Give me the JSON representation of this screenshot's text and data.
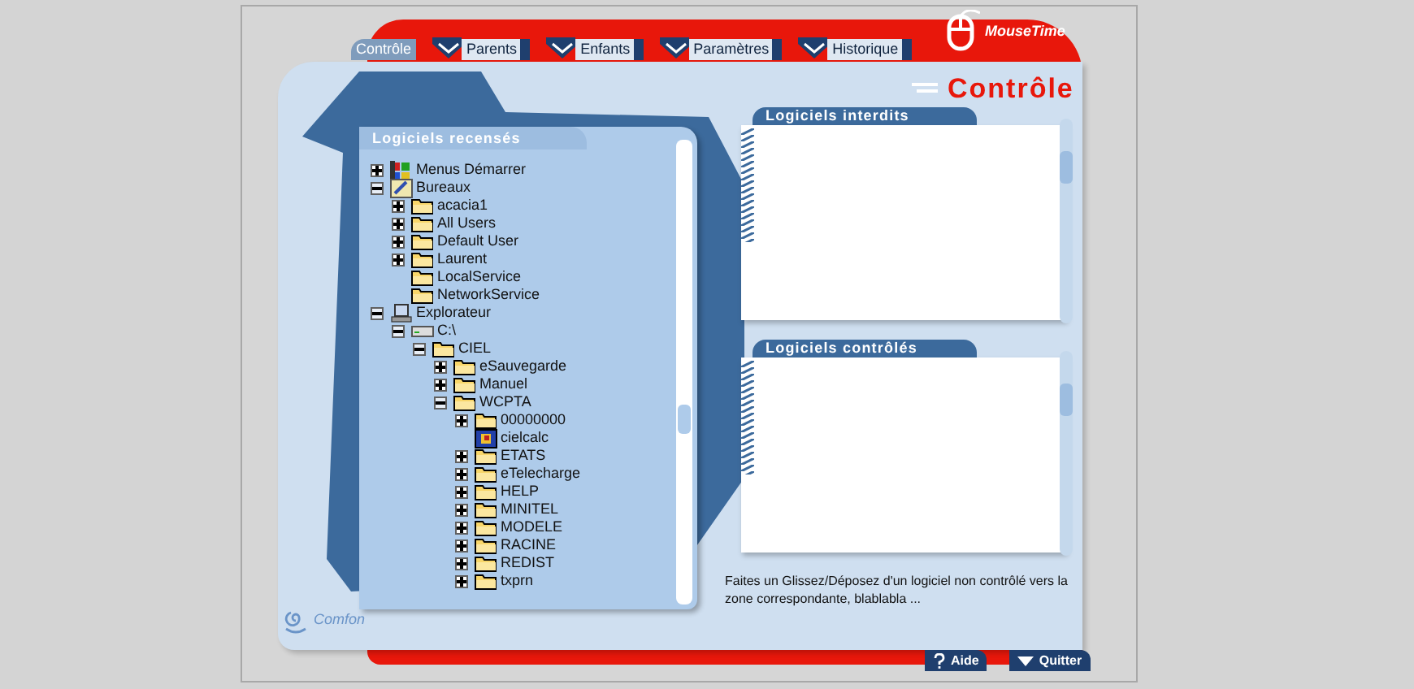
{
  "brand": {
    "name": "MouseTime"
  },
  "tabs": [
    {
      "label": "Contrôle",
      "selected": true
    },
    {
      "label": "Parents",
      "selected": false
    },
    {
      "label": "Enfants",
      "selected": false
    },
    {
      "label": "Paramètres",
      "selected": false
    },
    {
      "label": "Historique",
      "selected": false
    }
  ],
  "page_title": "Contrôle",
  "tree": {
    "title": "Logiciels recensés",
    "items": [
      {
        "label": "Menus Démarrer",
        "kind": "start",
        "expandable": true,
        "expanded": false
      },
      {
        "label": "Bureaux",
        "kind": "desktop",
        "expandable": true,
        "expanded": true,
        "children": [
          {
            "label": "acacia1",
            "kind": "folder",
            "expandable": true,
            "expanded": false
          },
          {
            "label": "All Users",
            "kind": "folder",
            "expandable": true,
            "expanded": false
          },
          {
            "label": "Default User",
            "kind": "folder",
            "expandable": true,
            "expanded": false
          },
          {
            "label": "Laurent",
            "kind": "folder",
            "expandable": true,
            "expanded": false
          },
          {
            "label": "LocalService",
            "kind": "folder",
            "expandable": false
          },
          {
            "label": "NetworkService",
            "kind": "folder",
            "expandable": false
          }
        ]
      },
      {
        "label": "Explorateur",
        "kind": "computer",
        "expandable": true,
        "expanded": true,
        "children": [
          {
            "label": "C:\\",
            "kind": "drive",
            "expandable": true,
            "expanded": true,
            "children": [
              {
                "label": "CIEL",
                "kind": "folder",
                "expandable": true,
                "expanded": true,
                "children": [
                  {
                    "label": "eSauvegarde",
                    "kind": "folder",
                    "expandable": true,
                    "expanded": false
                  },
                  {
                    "label": "Manuel",
                    "kind": "folder",
                    "expandable": true,
                    "expanded": false
                  },
                  {
                    "label": "WCPTA",
                    "kind": "folder",
                    "expandable": true,
                    "expanded": true,
                    "children": [
                      {
                        "label": "00000000",
                        "kind": "folder",
                        "expandable": true,
                        "expanded": false
                      },
                      {
                        "label": "cielcalc",
                        "kind": "app",
                        "expandable": false
                      },
                      {
                        "label": "ETATS",
                        "kind": "folder",
                        "expandable": true,
                        "expanded": false
                      },
                      {
                        "label": "eTelecharge",
                        "kind": "folder",
                        "expandable": true,
                        "expanded": false
                      },
                      {
                        "label": "HELP",
                        "kind": "folder",
                        "expandable": true,
                        "expanded": false
                      },
                      {
                        "label": "MINITEL",
                        "kind": "folder",
                        "expandable": true,
                        "expanded": false
                      },
                      {
                        "label": "MODELE",
                        "kind": "folder",
                        "expandable": true,
                        "expanded": false
                      },
                      {
                        "label": "RACINE",
                        "kind": "folder",
                        "expandable": true,
                        "expanded": false
                      },
                      {
                        "label": "REDIST",
                        "kind": "folder",
                        "expandable": true,
                        "expanded": false
                      },
                      {
                        "label": "txprn",
                        "kind": "folder",
                        "expandable": true,
                        "expanded": false
                      }
                    ]
                  }
                ]
              }
            ]
          }
        ]
      }
    ]
  },
  "lists": [
    {
      "title": "Logiciels interdits"
    },
    {
      "title": "Logiciels contrôlés"
    }
  ],
  "hint": "Faites un Glissez/Déposez d'un logiciel non contrôlé vers la zone correspondante, blablabla ...",
  "footer_logo": "Comfon",
  "buttons": [
    {
      "label": "Aide",
      "kind": "help"
    },
    {
      "label": "Quitter",
      "kind": "quit"
    }
  ]
}
